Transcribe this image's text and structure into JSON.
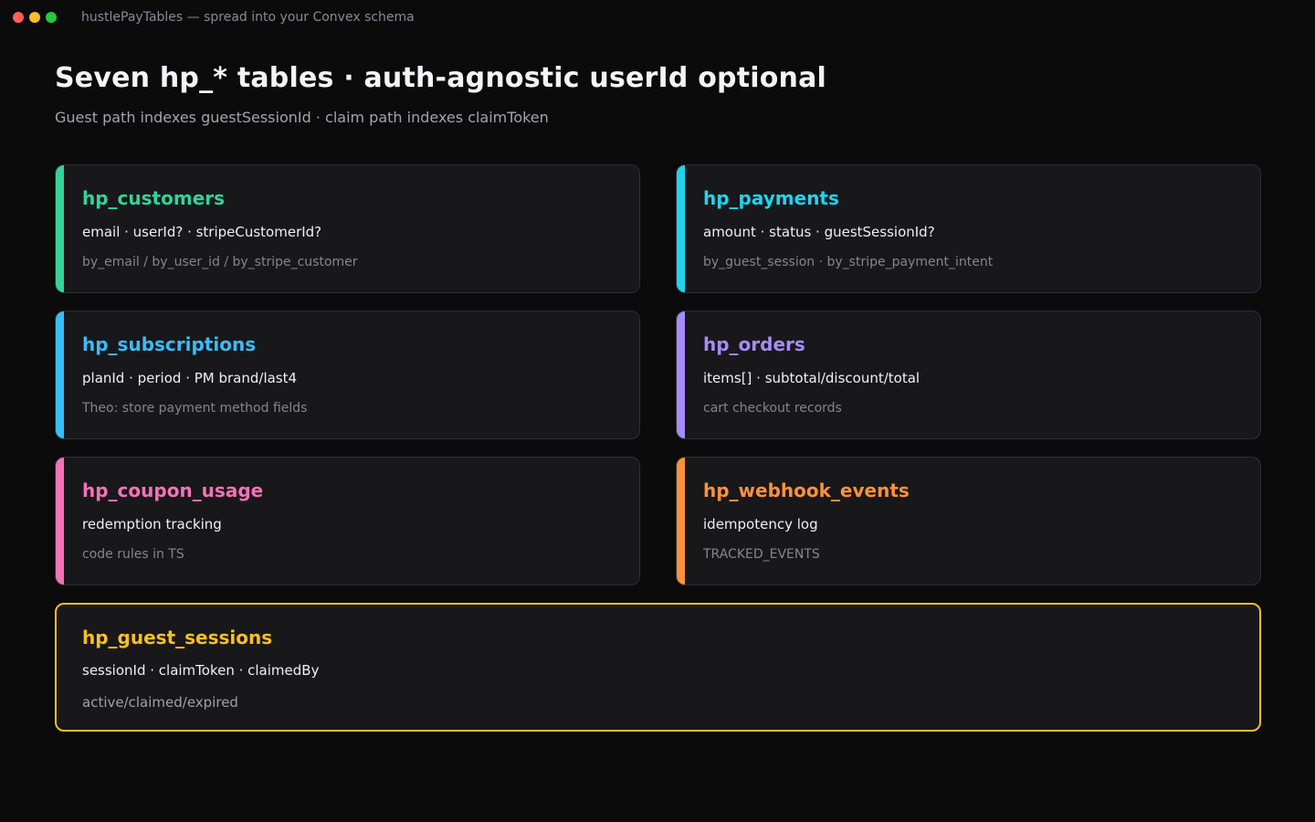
{
  "window": {
    "title": "hustlePayTables — spread into your Convex schema",
    "traffic_lights": [
      "#ff5f57",
      "#febc2e",
      "#28c840"
    ]
  },
  "header": {
    "title": "Seven hp_* tables · auth-agnostic userId optional",
    "subtitle": "Guest path indexes guestSessionId · claim path indexes claimToken"
  },
  "tables": [
    {
      "name": "hp_customers",
      "fields": "email · userId? · stripeCustomerId?",
      "note": "by_email / by_user_id / by_stripe_customer",
      "color": "#34d399"
    },
    {
      "name": "hp_payments",
      "fields": "amount · status · guestSessionId?",
      "note": "by_guest_session · by_stripe_payment_intent",
      "color": "#22d3ee"
    },
    {
      "name": "hp_subscriptions",
      "fields": "planId · period · PM brand/last4",
      "note": "Theo: store payment method fields",
      "color": "#38bdf8"
    },
    {
      "name": "hp_orders",
      "fields": "items[] · subtotal/discount/total",
      "note": "cart checkout records",
      "color": "#a78bfa"
    },
    {
      "name": "hp_coupon_usage",
      "fields": "redemption tracking",
      "note": "code rules in TS",
      "color": "#f472b6"
    },
    {
      "name": "hp_webhook_events",
      "fields": "idempotency log",
      "note": "TRACKED_EVENTS",
      "color": "#fb923c"
    },
    {
      "name": "hp_guest_sessions",
      "fields": "sessionId · claimToken · claimedBy",
      "note": "active/claimed/expired",
      "color": "#fbbf24"
    }
  ]
}
